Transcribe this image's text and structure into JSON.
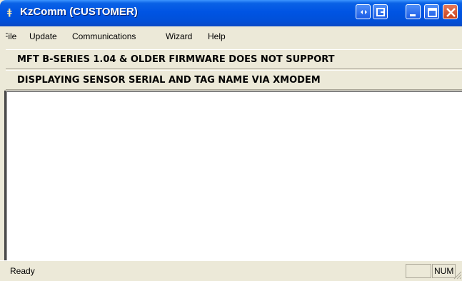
{
  "window": {
    "title": "KzComm (CUSTOMER)",
    "icon": "kz-app-icon",
    "controls": [
      "extra-left-icon",
      "extra-window-icon",
      "minimize-icon",
      "maximize-icon",
      "close-icon"
    ]
  },
  "menu": {
    "items": [
      "File",
      "Update",
      "Communications",
      "Wizard",
      "Help"
    ]
  },
  "banner": {
    "line1": "MFT B-SERIES 1.04 & OLDER FIRMWARE DOES NOT SUPPORT",
    "line2": "DISPLAYING SENSOR SERIAL AND TAG NAME VIA XMODEM"
  },
  "status": {
    "text": "Ready",
    "num": "NUM"
  },
  "colors": {
    "titlebar": "#0054e3",
    "chrome": "#ece9d8",
    "close": "#c8411b"
  }
}
